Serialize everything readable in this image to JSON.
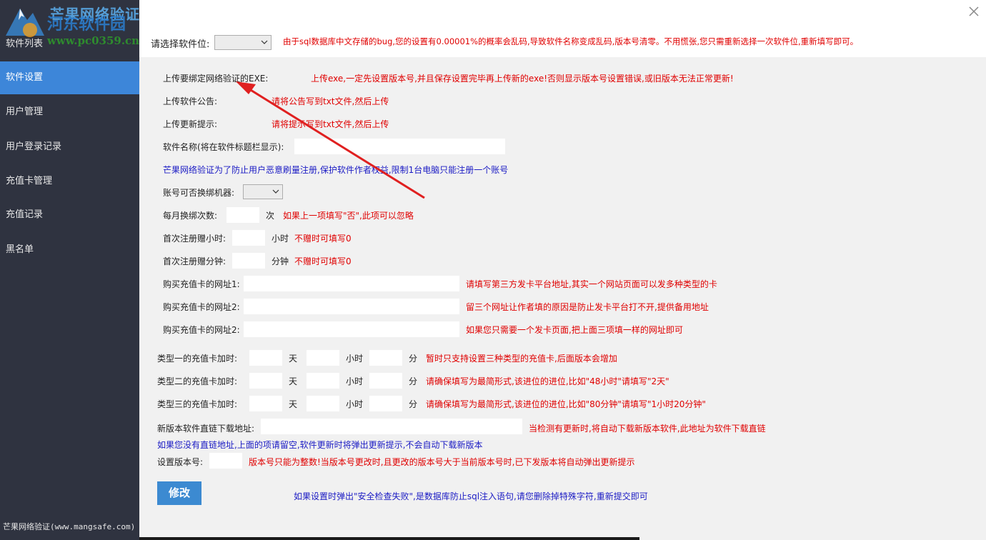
{
  "sidebar": {
    "items": [
      {
        "label": "软件列表"
      },
      {
        "label": "软件设置"
      },
      {
        "label": "用户管理"
      },
      {
        "label": "用户登录记录"
      },
      {
        "label": "充值卡管理"
      },
      {
        "label": "充值记录"
      },
      {
        "label": "黑名单"
      }
    ],
    "active_index": 1,
    "footer": "芒果网络验证(www.mangsafe.com)"
  },
  "watermark": {
    "line1": "芒果网络验证",
    "line2": "河东软件园",
    "line3": "www.pc0359.cn"
  },
  "top": {
    "software_select_label": "请选择软件位:",
    "software_select_value": "",
    "notice": "由于sql数据库中文存储的bug,您的设置有0.00001%的概率会乱码,导致软件名称变成乱码,版本号清零。不用慌张,您只需重新选择一次软件位,重新填写即可。"
  },
  "form": {
    "upload_exe_label": "上传要绑定网络验证的EXE:",
    "upload_exe_hint": "上传exe,一定先设置版本号,并且保存设置完毕再上传新的exe!否则显示版本号设置错误,或旧版本无法正常更新!",
    "upload_notice_label": "上传软件公告:",
    "upload_notice_hint": "请将公告写到txt文件,然后上传",
    "upload_update_label": "上传更新提示:",
    "upload_update_hint": "请将提示写到txt文件,然后上传",
    "name_label": "软件名称(将在软件标题栏显示):",
    "name_value": "",
    "anti_abuse_note": "芒果网络验证为了防止用户恶意刷量注册,保护软件作者权益,限制1台电脑只能注册一个账号",
    "rebind_label": "账号可否换绑机器:",
    "rebind_value": "",
    "monthly_rebind_label": "每月换绑次数:",
    "monthly_rebind_value": "",
    "monthly_rebind_unit": "次",
    "monthly_rebind_hint": "如果上一项填写\"否\",此项可以忽略",
    "first_hours_label": "首次注册赠小时:",
    "first_hours_value": "",
    "first_hours_unit": "小时",
    "first_hours_hint": "不赠时可填写0",
    "first_minutes_label": "首次注册赠分钟:",
    "first_minutes_value": "",
    "first_minutes_unit": "分钟",
    "first_minutes_hint": "不赠时可填写0",
    "url1_label": "购买充值卡的网址1:",
    "url1_hint": "请填写第三方发卡平台地址,其实一个网站页面可以发多种类型的卡",
    "url2_label": "购买充值卡的网址2:",
    "url2_hint": "留三个网址让作者填的原因是防止发卡平台打不开,提供备用地址",
    "url3_label": "购买充值卡的网址2:",
    "url3_hint": "如果您只需要一个发卡页面,把上面三项填一样的网址即可",
    "card_rows": [
      {
        "label": "类型一的充值卡加时:",
        "hint": "暂时只支持设置三种类型的充值卡,后面版本会增加"
      },
      {
        "label": "类型二的充值卡加时:",
        "hint": "请确保填写为最简形式,该进位的进位,比如\"48小时\"请填写\"2天\""
      },
      {
        "label": "类型三的充值卡加时:",
        "hint": "请确保填写为最简形式,该进位的进位,比如\"80分钟\"请填写\"1小时20分钟\""
      }
    ],
    "unit_day": "天",
    "unit_hour": "小时",
    "unit_minute": "分",
    "download_label": "新版本软件直链下载地址:",
    "download_hint": "当检测有更新时,将自动下载新版本软件,此地址为软件下载直链",
    "download_note": "如果您没有直链地址,上面的项请留空,软件更新时将弹出更新提示,不会自动下载新版本",
    "version_label": "设置版本号:",
    "version_hint": "版本号只能为整数!当版本号更改时,且更改的版本号大于当前版本号时,已下发版本将自动弹出更新提示",
    "submit_label": "修改",
    "security_note": "如果设置时弹出\"安全检查失败\",是数据库防止sql注入语句,请您删除掉特殊字符,重新提交即可"
  },
  "colors": {
    "sidebar_bg": "#2f3340",
    "active_item": "#3d86d9",
    "hint_red": "#e00000",
    "note_blue": "#1b1bc4",
    "button": "#3c8ad1",
    "arrow": "#e02020"
  }
}
